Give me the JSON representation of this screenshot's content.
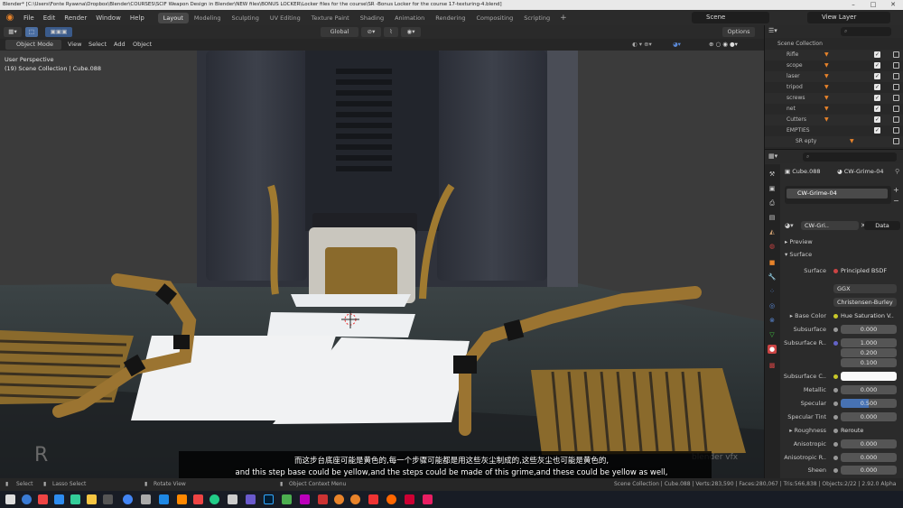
{
  "window": {
    "title": "Blender* [C:\\Users\\Fonte Ryawna\\Dropbox\\Blender\\COURSES\\SCIF Weapon Design in Blender\\NEW files\\BONUS LOCKER\\Locker files for the course\\SR -Bonus Locker for the course 17-texturing-4.blend]"
  },
  "menu": [
    "File",
    "Edit",
    "Render",
    "Window",
    "Help"
  ],
  "workspaces": [
    "Layout",
    "Modeling",
    "Sculpting",
    "UV Editing",
    "Texture Paint",
    "Shading",
    "Animation",
    "Rendering",
    "Compositing",
    "Scripting"
  ],
  "scene": "Scene",
  "view_layer": "View Layer",
  "toolheader": {
    "orientation": "Global",
    "options": "Options"
  },
  "viewport_header": {
    "mode": "Object Mode",
    "menus": [
      "View",
      "Select",
      "Add",
      "Object"
    ]
  },
  "viewport": {
    "perspective": "User Perspective",
    "collection_info": "(19) Scene Collection | Cube.088"
  },
  "subtitles": {
    "zh": "而这步台底座可能是黄色的,每一个步骤可能都是用这些灰尘制成的,这些灰尘也可能是黄色的,",
    "en": "and this step base could be yellow,and the steps could be made of this grime,and these could be yellow as well,"
  },
  "outliner": {
    "root": "Scene Collection",
    "items": [
      "Rifle",
      "scope",
      "laser",
      "tripod",
      "screws",
      "net",
      "Cutters",
      "EMPTIES",
      "SR epty"
    ]
  },
  "properties": {
    "object": "Cube.088",
    "material_name": "CW-Grime-04",
    "slot": "CW-Grime-04",
    "material_short": "CW-Gri..",
    "data_label": "Data",
    "panels": {
      "preview": "Preview",
      "surface": "Surface"
    },
    "surface_label": "Surface",
    "shader": "Principled BSDF",
    "distribution": "GGX",
    "subsurface_method": "Christensen-Burley",
    "rows": [
      {
        "label": "Base Color",
        "value": "Hue Saturation V.."
      },
      {
        "label": "Subsurface",
        "value": "0.000"
      },
      {
        "label": "Subsurface R..",
        "value": "1.000"
      },
      {
        "label": "",
        "value": "0.200"
      },
      {
        "label": "",
        "value": "0.100"
      },
      {
        "label": "Subsurface C..",
        "value": ""
      },
      {
        "label": "Metallic",
        "value": "0.000"
      },
      {
        "label": "Specular",
        "value": "0.500"
      },
      {
        "label": "Specular Tint",
        "value": "0.000"
      },
      {
        "label": "Roughness",
        "value": "Reroute"
      },
      {
        "label": "Anisotropic",
        "value": "0.000"
      },
      {
        "label": "Anisotropic R..",
        "value": "0.000"
      },
      {
        "label": "Sheen",
        "value": "0.000"
      }
    ]
  },
  "statusbar": {
    "select": "Select",
    "lasso": "Lasso Select",
    "rotate": "Rotate View",
    "context": "Object Context Menu",
    "stats": "Scene Collection | Cube.088 | Verts:283,590 | Faces:280,067 | Tris:566,838 | Objects:2/22 | 2.92.0 Alpha"
  },
  "watermark": "blender vfx"
}
